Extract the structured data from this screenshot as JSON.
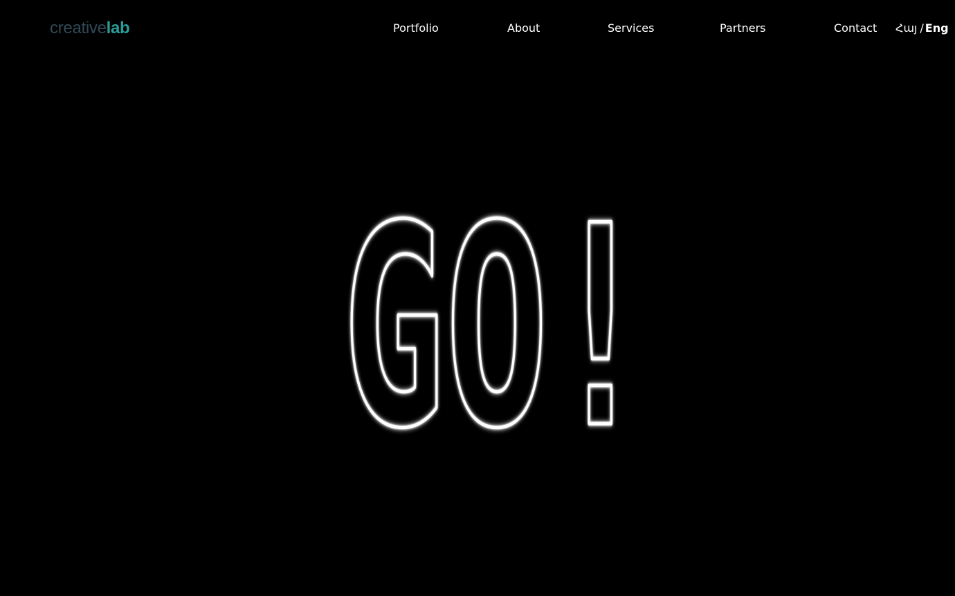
{
  "logo": {
    "part1": "creative",
    "part2": "lab"
  },
  "nav": {
    "items": [
      {
        "label": "Portfolio"
      },
      {
        "label": "About"
      },
      {
        "label": "Services"
      },
      {
        "label": "Partners"
      },
      {
        "label": "Contact"
      }
    ]
  },
  "language": {
    "armenian": "Հայ",
    "separator": "/",
    "english": "Eng"
  },
  "hero": {
    "text": "GO!"
  },
  "colors": {
    "background": "#000000",
    "text": "#ffffff",
    "logo_dark": "#314a56",
    "logo_accent": "#2b9c98",
    "glow": "#ffffff"
  }
}
